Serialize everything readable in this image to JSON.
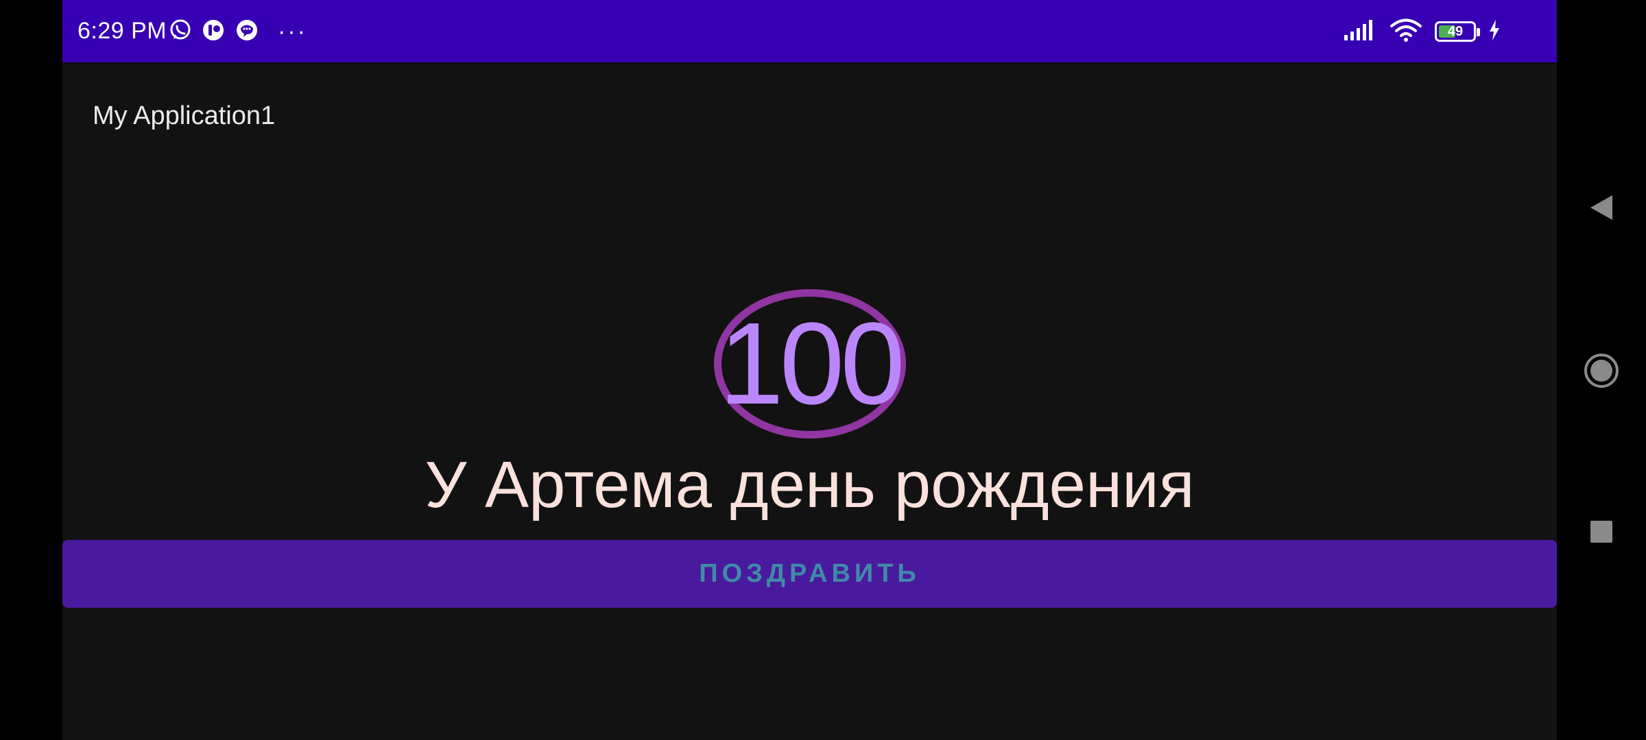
{
  "status_bar": {
    "time": "6:29 PM",
    "notification_icons": [
      "whatsapp-icon",
      "app-notification-icon",
      "chat-notification-icon"
    ],
    "more": "···",
    "battery_percent": 49,
    "battery_label": "49",
    "colors": {
      "background": "#3700b3",
      "battery_fill": "#4caf50"
    }
  },
  "app": {
    "title": "My Application1",
    "colors": {
      "background": "#121212",
      "accent": "#bb86fc",
      "button": "#4a1a9e"
    }
  },
  "main": {
    "count": "100",
    "message": "У Артема день рождения",
    "button_label": "ПОЗДРАВИТЬ"
  },
  "nav_bar": {
    "buttons": [
      "back-icon",
      "home-icon",
      "recents-icon"
    ]
  }
}
